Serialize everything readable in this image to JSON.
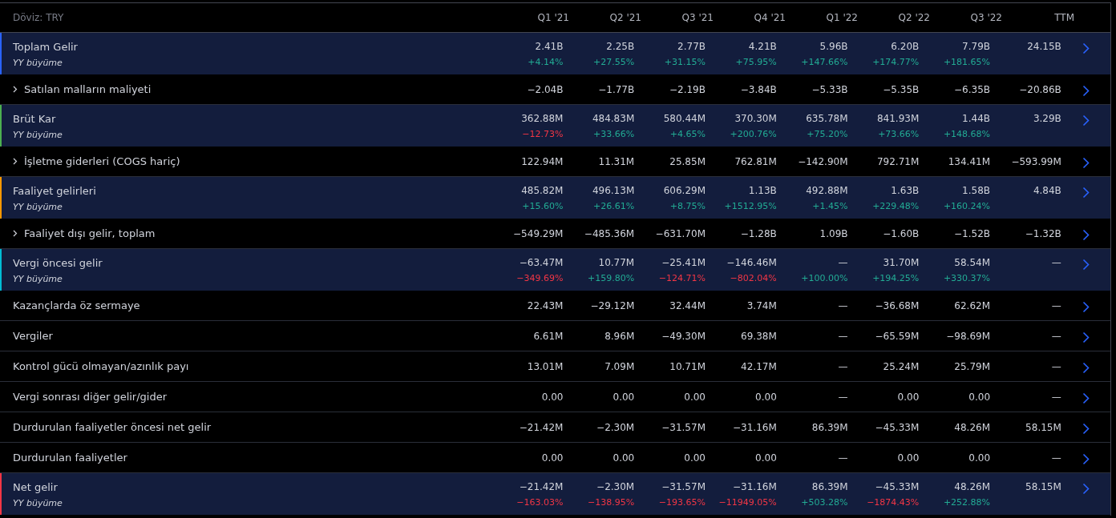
{
  "header": {
    "currency": "Döviz: TRY",
    "periods": [
      "Q1 '21",
      "Q2 '21",
      "Q3 '21",
      "Q4 '21",
      "Q1 '22",
      "Q2 '22",
      "Q3 '22",
      "TTM"
    ]
  },
  "rows": [
    {
      "kind": "highlight",
      "color": "#2962ff",
      "label": "Toplam Gelir",
      "sublabel": "YY büyüme",
      "values": [
        "2.41B",
        "2.25B",
        "2.77B",
        "4.21B",
        "5.96B",
        "6.20B",
        "7.79B",
        "24.15B"
      ],
      "growth": [
        {
          "text": "+4.14%",
          "up": true
        },
        {
          "text": "+27.55%",
          "up": true
        },
        {
          "text": "+31.15%",
          "up": true
        },
        {
          "text": "+75.95%",
          "up": true
        },
        {
          "text": "+147.66%",
          "up": true
        },
        {
          "text": "+174.77%",
          "up": true
        },
        {
          "text": "+181.65%",
          "up": true
        }
      ]
    },
    {
      "kind": "expandable",
      "label": "Satılan malların maliyeti",
      "values": [
        "−2.04B",
        "−1.77B",
        "−2.19B",
        "−3.84B",
        "−5.33B",
        "−5.35B",
        "−6.35B",
        "−20.86B"
      ]
    },
    {
      "kind": "highlight",
      "color": "#4caf50",
      "label": "Brüt Kar",
      "sublabel": "YY büyüme",
      "values": [
        "362.88M",
        "484.83M",
        "580.44M",
        "370.30M",
        "635.78M",
        "841.93M",
        "1.44B",
        "3.29B"
      ],
      "growth": [
        {
          "text": "−12.73%",
          "up": false
        },
        {
          "text": "+33.66%",
          "up": true
        },
        {
          "text": "+4.65%",
          "up": true
        },
        {
          "text": "+200.76%",
          "up": true
        },
        {
          "text": "+75.20%",
          "up": true
        },
        {
          "text": "+73.66%",
          "up": true
        },
        {
          "text": "+148.68%",
          "up": true
        }
      ]
    },
    {
      "kind": "expandable",
      "label": "İşletme giderleri (COGS hariç)",
      "values": [
        "122.94M",
        "11.31M",
        "25.85M",
        "762.81M",
        "−142.90M",
        "792.71M",
        "134.41M",
        "−593.99M"
      ]
    },
    {
      "kind": "highlight",
      "color": "#ff9800",
      "label": "Faaliyet gelirleri",
      "sublabel": "YY büyüme",
      "values": [
        "485.82M",
        "496.13M",
        "606.29M",
        "1.13B",
        "492.88M",
        "1.63B",
        "1.58B",
        "4.84B"
      ],
      "growth": [
        {
          "text": "+15.60%",
          "up": true
        },
        {
          "text": "+26.61%",
          "up": true
        },
        {
          "text": "+8.75%",
          "up": true
        },
        {
          "text": "+1512.95%",
          "up": true
        },
        {
          "text": "+1.45%",
          "up": true
        },
        {
          "text": "+229.48%",
          "up": true
        },
        {
          "text": "+160.24%",
          "up": true
        }
      ]
    },
    {
      "kind": "expandable",
      "label": "Faaliyet dışı gelir, toplam",
      "values": [
        "−549.29M",
        "−485.36M",
        "−631.70M",
        "−1.28B",
        "1.09B",
        "−1.60B",
        "−1.52B",
        "−1.32B"
      ]
    },
    {
      "kind": "highlight",
      "color": "#00bcd4",
      "label": "Vergi öncesi gelir",
      "sublabel": "YY büyüme",
      "values": [
        "−63.47M",
        "10.77M",
        "−25.41M",
        "−146.46M",
        "—",
        "31.70M",
        "58.54M",
        "—"
      ],
      "growth": [
        {
          "text": "−349.69%",
          "up": false
        },
        {
          "text": "+159.80%",
          "up": true
        },
        {
          "text": "−124.71%",
          "up": false
        },
        {
          "text": "−802.04%",
          "up": false
        },
        {
          "text": "+100.00%",
          "up": true
        },
        {
          "text": "+194.25%",
          "up": true
        },
        {
          "text": "+330.37%",
          "up": true
        }
      ]
    },
    {
      "kind": "plain",
      "label": "Kazançlarda öz sermaye",
      "values": [
        "22.43M",
        "−29.12M",
        "32.44M",
        "3.74M",
        "—",
        "−36.68M",
        "62.62M",
        "—"
      ]
    },
    {
      "kind": "plain",
      "label": "Vergiler",
      "values": [
        "6.61M",
        "8.96M",
        "−49.30M",
        "69.38M",
        "—",
        "−65.59M",
        "−98.69M",
        "—"
      ]
    },
    {
      "kind": "plain",
      "label": "Kontrol gücü olmayan/azınlık payı",
      "values": [
        "13.01M",
        "7.09M",
        "10.71M",
        "42.17M",
        "—",
        "25.24M",
        "25.79M",
        "—"
      ]
    },
    {
      "kind": "plain",
      "label": "Vergi sonrası diğer gelir/gider",
      "values": [
        "0.00",
        "0.00",
        "0.00",
        "0.00",
        "—",
        "0.00",
        "0.00",
        "—"
      ]
    },
    {
      "kind": "plain",
      "label": "Durdurulan faaliyetler öncesi net gelir",
      "values": [
        "−21.42M",
        "−2.30M",
        "−31.57M",
        "−31.16M",
        "86.39M",
        "−45.33M",
        "48.26M",
        "58.15M"
      ]
    },
    {
      "kind": "plain",
      "label": "Durdurulan faaliyetler",
      "values": [
        "0.00",
        "0.00",
        "0.00",
        "0.00",
        "—",
        "0.00",
        "0.00",
        "—"
      ]
    },
    {
      "kind": "highlight",
      "color": "#f23645",
      "label": "Net gelir",
      "sublabel": "YY büyüme",
      "values": [
        "−21.42M",
        "−2.30M",
        "−31.57M",
        "−31.16M",
        "86.39M",
        "−45.33M",
        "48.26M",
        "58.15M"
      ],
      "growth": [
        {
          "text": "−163.03%",
          "up": false
        },
        {
          "text": "−138.95%",
          "up": false
        },
        {
          "text": "−193.65%",
          "up": false
        },
        {
          "text": "−11949.05%",
          "up": false
        },
        {
          "text": "+503.28%",
          "up": true
        },
        {
          "text": "−1874.43%",
          "up": false
        },
        {
          "text": "+252.88%",
          "up": true
        }
      ]
    }
  ]
}
